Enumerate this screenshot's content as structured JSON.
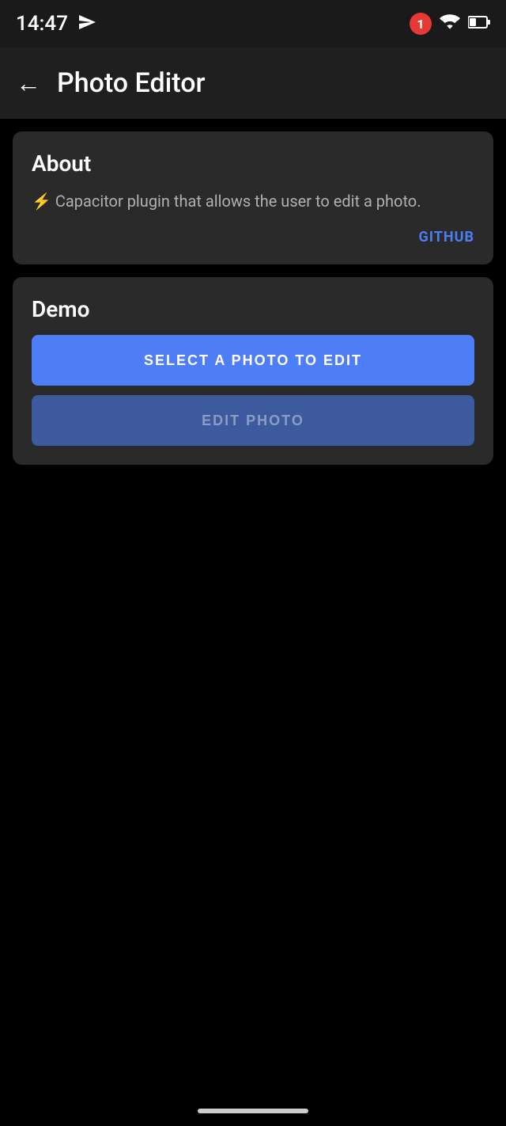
{
  "statusBar": {
    "time": "14:47",
    "notificationCount": "1"
  },
  "appBar": {
    "title": "Photo Editor",
    "backLabel": "←"
  },
  "about": {
    "sectionTitle": "About",
    "description": "⚡ Capacitor plugin that allows the user to edit a photo.",
    "githubLabel": "GITHUB"
  },
  "demo": {
    "sectionTitle": "Demo",
    "selectButtonLabel": "SELECT A PHOTO TO EDIT",
    "editButtonLabel": "EDIT PHOTO"
  },
  "colors": {
    "accent": "#4e7ef7",
    "primaryButton": "#4e7ef7",
    "secondaryButton": "#3d5a9e",
    "secondaryButtonText": "#8a9dc4",
    "background": "#000000",
    "cardBackground": "#2a2a2a",
    "appBarBackground": "#1f1f1f"
  }
}
